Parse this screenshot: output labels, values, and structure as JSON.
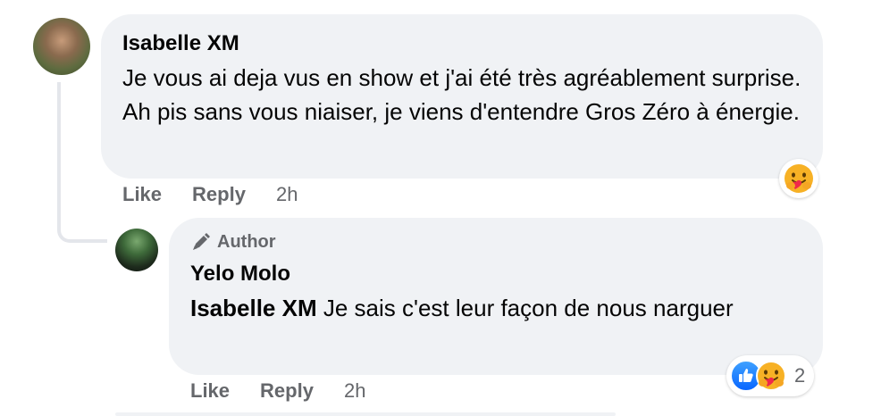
{
  "comment": {
    "author": "Isabelle XM",
    "text": "Je vous ai deja vus en show et j'ai été très agréablement surprise. Ah pis sans vous niaiser, je viens d'entendre Gros Zéro à énergie.",
    "actions": {
      "like": "Like",
      "reply": "Reply",
      "time": "2h"
    },
    "reaction_icon": "care-emoji-icon"
  },
  "reply": {
    "badge": "Author",
    "badge_icon": "pen-icon",
    "author": "Yelo Molo",
    "mention": "Isabelle XM",
    "text": "Je sais c'est leur façon de nous narguer",
    "actions": {
      "like": "Like",
      "reply": "Reply",
      "time": "2h"
    },
    "reaction_icons": [
      "like-icon",
      "care-emoji-icon"
    ],
    "reaction_count": "2"
  },
  "colors": {
    "bubble": "#f0f2f5",
    "secondary_text": "#65676b",
    "like_blue": "#0866ff"
  }
}
